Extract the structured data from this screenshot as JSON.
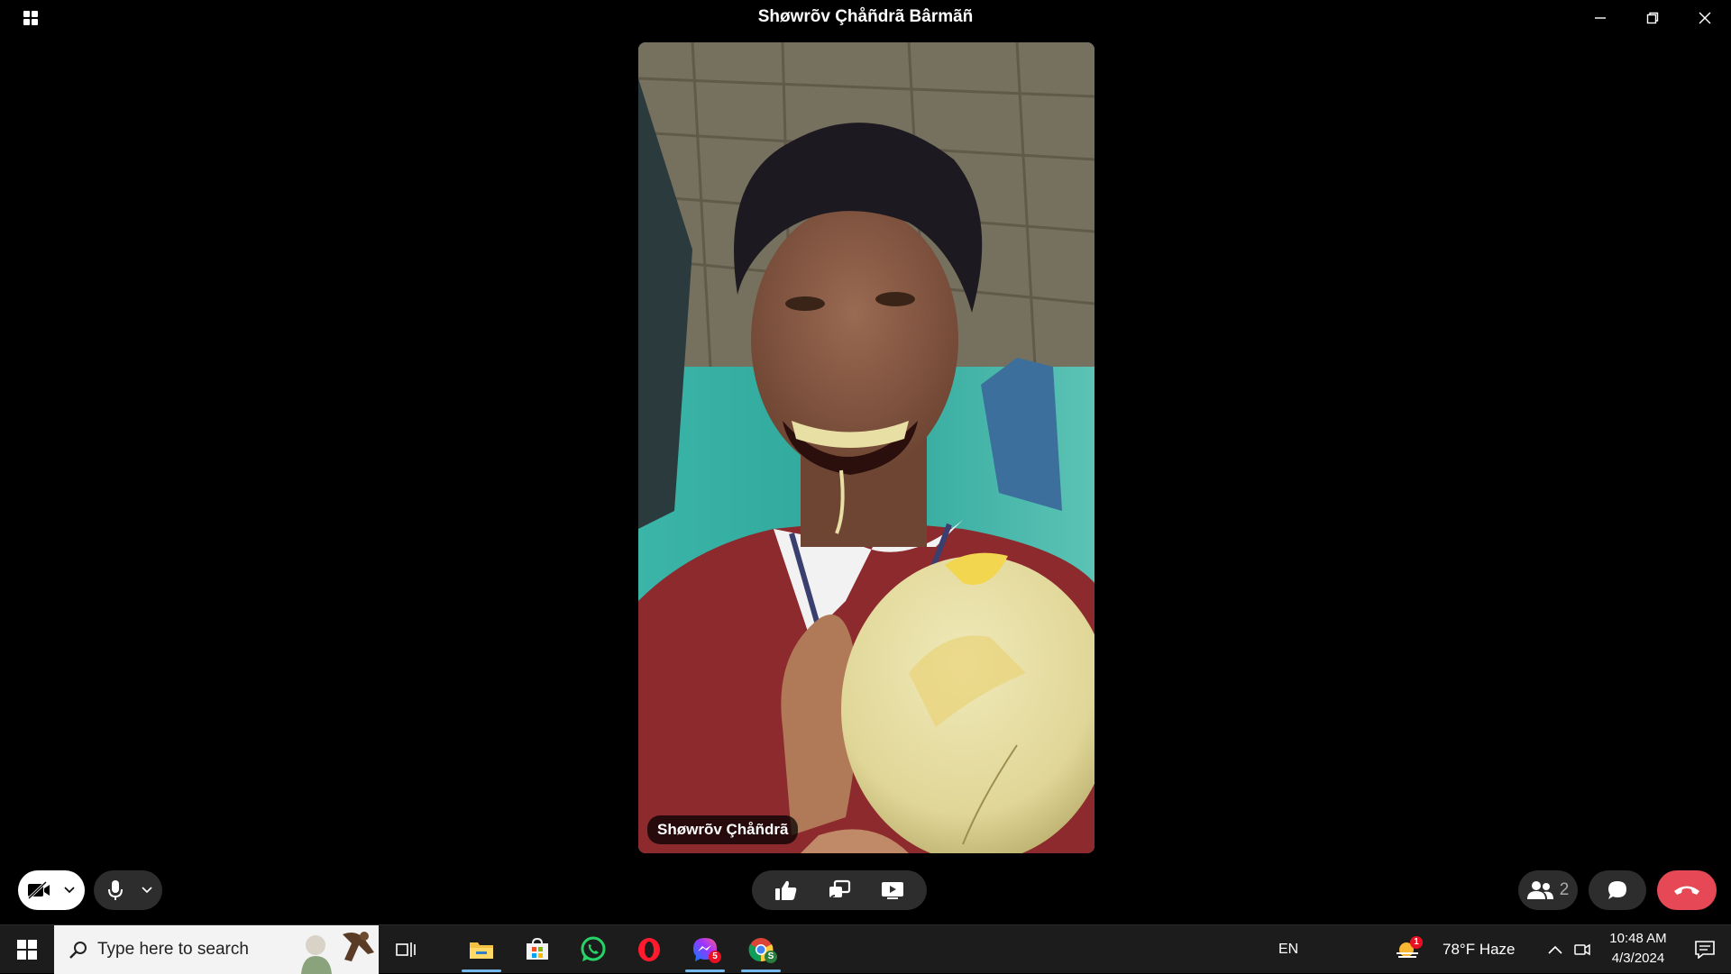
{
  "window": {
    "title": "Shøwrõv Çhåñdrã Bârmãñ",
    "controls": [
      "minimize-icon",
      "restore-icon",
      "close-icon"
    ]
  },
  "video": {
    "participant_name": "Shøwrõv Çhåñdrã"
  },
  "call_controls": {
    "left": [
      "camera-off-icon",
      "chevron-down-icon",
      "microphone-icon",
      "chevron-down-icon"
    ],
    "center": [
      "thumbs-up-icon",
      "cast-icon",
      "share-screen-icon"
    ],
    "participants_count": "2",
    "right": [
      "people-icon",
      "chat-icon",
      "end-call-icon"
    ],
    "end_call_color": "#e74856"
  },
  "taskbar": {
    "search_placeholder": "Type here to search",
    "apps": [
      "file-explorer-icon",
      "microsoft-store-icon",
      "whatsapp-icon",
      "opera-icon",
      "messenger-icon",
      "chrome-icon"
    ],
    "messenger_badge": "5",
    "language": "EN",
    "weather": "78°F  Haze",
    "weather_badge": "1",
    "time": "10:48 AM",
    "date": "4/3/2024"
  }
}
